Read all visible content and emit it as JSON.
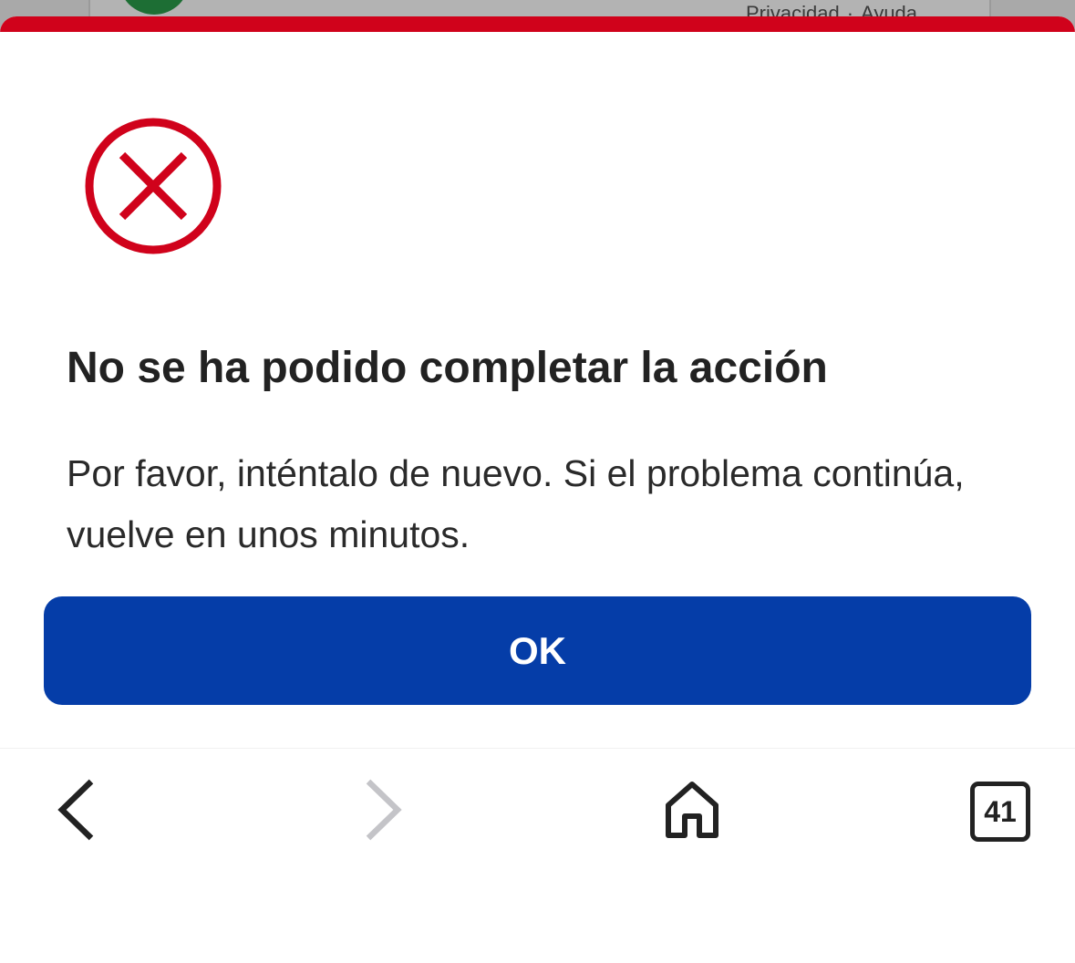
{
  "background_page": {
    "links": [
      "Privacidad",
      "·",
      "Ayuda"
    ]
  },
  "dialog": {
    "icon": "error-circle-x-icon",
    "title": "No se ha podido completar la acción",
    "message": "Por favor, inténtalo de nuevo. Si el problema continúa, vuelve en unos minutos.",
    "ok_label": "OK"
  },
  "toolbar": {
    "back_icon": "chevron-left-icon",
    "forward_icon": "chevron-right-icon",
    "home_icon": "home-icon",
    "tabs_count": "41"
  },
  "colors": {
    "error_red": "#d0021b",
    "primary_blue": "#053da8",
    "text_dark": "#222222",
    "disabled_gray": "#c4c4c8"
  }
}
